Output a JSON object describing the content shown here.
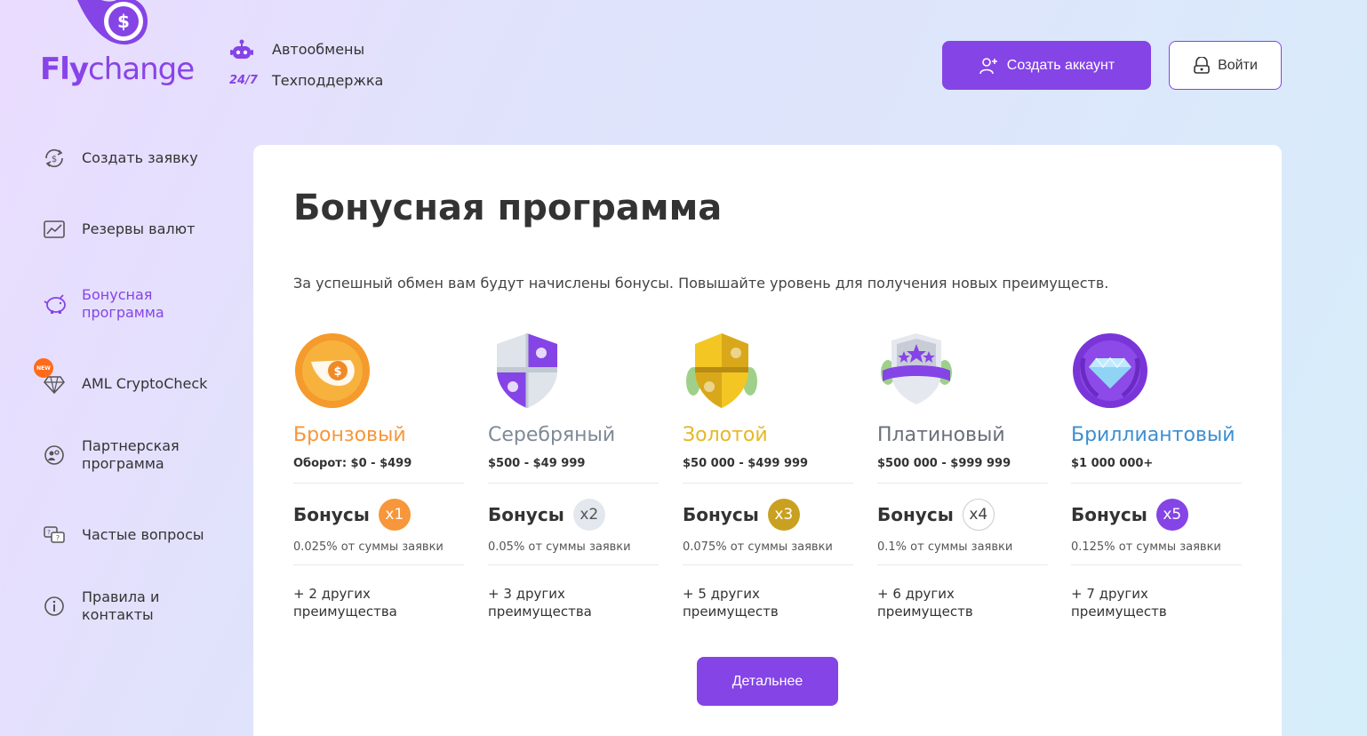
{
  "logo": {
    "part1": "Fly",
    "part2": "change"
  },
  "topinfo": {
    "auto_label": "Автообмены",
    "support_badge": "24/7",
    "support_label": "Техподдержка"
  },
  "header": {
    "create_account": "Создать аккаунт",
    "login": "Войти"
  },
  "sidebar": {
    "items": [
      {
        "label": "Создать заявку",
        "icon": "exchange-dollar-icon"
      },
      {
        "label": "Резервы валют",
        "icon": "chart-icon"
      },
      {
        "label": "Бонусная программа",
        "icon": "piggy-bank-icon",
        "active": true
      },
      {
        "label": "AML CryptoCheck",
        "icon": "diamond-icon",
        "badge": "NEW"
      },
      {
        "label": "Партнерская программа",
        "icon": "partner-icon"
      },
      {
        "label": "Частые вопросы",
        "icon": "faq-icon"
      },
      {
        "label": "Правила и контакты",
        "icon": "info-icon"
      }
    ]
  },
  "main": {
    "title": "Бонусная программа",
    "subtitle": "За успешный обмен вам будут начислены бонусы. Повышайте уровень для получения новых преимуществ.",
    "bonus_label": "Бонусы",
    "tiers": [
      {
        "name": "Бронзовый",
        "range": "Оборот: $0 - $499",
        "multiplier": "x1",
        "percent": "0.025% от суммы заявки",
        "other": "+ 2 других преимущества",
        "color": "#f7963a",
        "mult_bg": "#f7963a",
        "mult_color": "#ffffff"
      },
      {
        "name": "Серебряный",
        "range": "$500 - $49 999",
        "multiplier": "x2",
        "percent": "0.05% от суммы заявки",
        "other": "+ 3 других преимущества",
        "color": "#7e8a97",
        "mult_bg": "#e3e8ee",
        "mult_color": "#555555"
      },
      {
        "name": "Золотой",
        "range": "$50 000 - $499 999",
        "multiplier": "x3",
        "percent": "0.075% от суммы заявки",
        "other": "+ 5 других преимуществ",
        "color": "#e6b824",
        "mult_bg": "#c9a020",
        "mult_color": "#ffffff"
      },
      {
        "name": "Платиновый",
        "range": "$500 000 - $999 999",
        "multiplier": "x4",
        "percent": "0.1% от суммы заявки",
        "other": "+ 6 других преимуществ",
        "color": "#6b6f7a",
        "mult_bg": "#ffffff",
        "mult_color": "#444444"
      },
      {
        "name": "Бриллиантовый",
        "range": "$1 000 000+",
        "multiplier": "x5",
        "percent": "0.125% от суммы заявки",
        "other": "+ 7 других преимуществ",
        "color": "#3d8fd1",
        "mult_bg": "#8544e6",
        "mult_color": "#ffffff"
      }
    ],
    "details_button": "Детальнее"
  },
  "colors": {
    "accent": "#8544e6"
  }
}
